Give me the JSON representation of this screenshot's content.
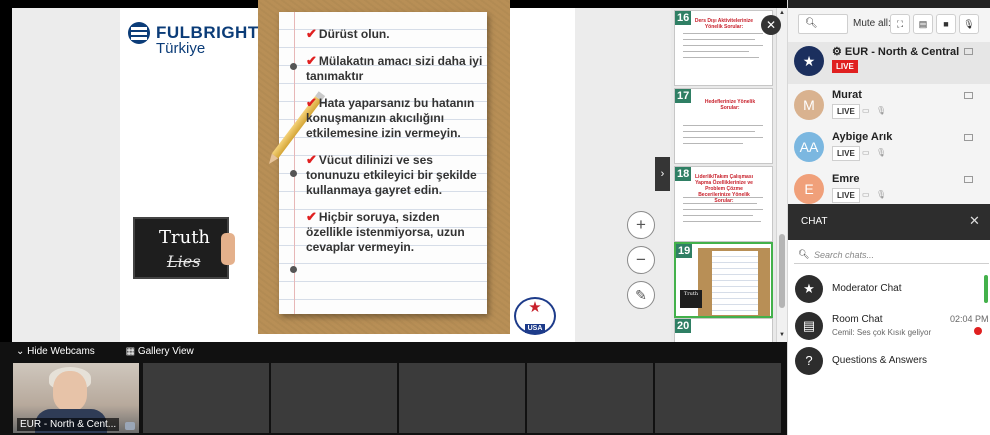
{
  "slide": {
    "logo": {
      "name": "FULBRIGHT",
      "country": "Türkiye"
    },
    "items": [
      "Dürüst olun.",
      "Mülakatın amacı sizi daha iyi tanımaktır",
      "Hata yaparsanız bu hatanın konuşmanızın akıcılığını etkilemesine izin vermeyin.",
      "Vücut dilinizi ve ses tonunuzu etkileyici bir şekilde kullanmaya gayret edin.",
      "Hiçbir soruya, sizden özellikle istenmiyorsa, uzun cevaplar vermeyin."
    ],
    "card": {
      "truth": "Truth",
      "lies": "Lies"
    },
    "seal": {
      "label": "USA"
    },
    "zoom_in": "+",
    "zoom_out": "−",
    "pen": "✎",
    "collapse": "›"
  },
  "thumbnails": [
    {
      "num": "16",
      "title": "Ders Dışı Aktivitelerinize Yönelik Sorular:"
    },
    {
      "num": "17",
      "title": "Hedeflerinize Yönelik Sorular:"
    },
    {
      "num": "18",
      "title": "Liderlik/Takım Çalışması Yapma Özelliklerinize ve Problem Çözme Becerilerinize Yönelik Sorular:"
    },
    {
      "num": "19",
      "title": ""
    },
    {
      "num": "20",
      "title": ""
    }
  ],
  "webcams": {
    "hide_label": "Hide Webcams",
    "gallery_label": "Gallery View",
    "tile_label": "EUR - North & Cent..."
  },
  "panel": {
    "mute_all": "Mute all:",
    "attendees": [
      {
        "initials": "",
        "name": "EUR - North & Central",
        "badge": "LIVE",
        "color": "#1b2f5e"
      },
      {
        "initials": "M",
        "name": "Murat",
        "badge": "LIVE",
        "color": "#d9b28f"
      },
      {
        "initials": "AA",
        "name": "Aybige Arık",
        "badge": "LIVE",
        "color": "#7bb7e0"
      },
      {
        "initials": "E",
        "name": "Emre",
        "badge": "LIVE",
        "color": "#f0a07a"
      }
    ],
    "chat": {
      "title": "CHAT",
      "search_placeholder": "Search chats...",
      "items": [
        {
          "name": "Moderator Chat",
          "sub": "",
          "time": ""
        },
        {
          "name": "Room Chat",
          "sub": "Cemil: Ses çok Kısık geliyor",
          "time": "02:04 PM"
        },
        {
          "name": "Questions & Answers",
          "sub": "",
          "time": ""
        }
      ]
    }
  }
}
